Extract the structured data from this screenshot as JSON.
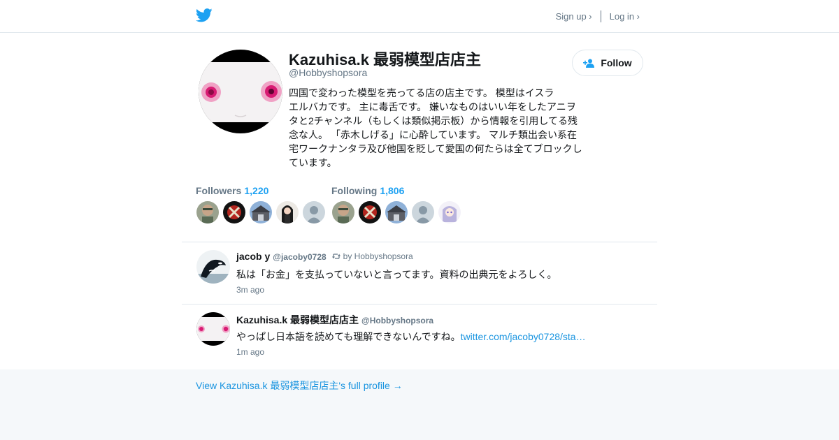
{
  "header": {
    "logo_icon": "twitter-bird-icon",
    "signup_label": "Sign up ›",
    "login_label": "Log in ›"
  },
  "profile": {
    "name": "Kazuhisa.k 最弱模型店店主",
    "handle": "@Hobbyshopsora",
    "bio_lines": [
      "四国で変わった模型を売ってる店の店主です。 模型はイスラ",
      "エルバカです。 主に毒舌です。 嫌いなものはいい年をしたアニヲ",
      "タと2チャンネル（もしくは類似掲示板）から情報を引用してる残",
      "念な人。 「赤木しげる」に心酔しています。 マルチ類出会い系在",
      "宅ワークナンタラ及び他国を貶して愛国の何たらは全てブロックし",
      "ています。"
    ],
    "follow_label": "Follow",
    "followers_label": "Followers",
    "followers_count": "1,220",
    "following_label": "Following",
    "following_count": "1,806"
  },
  "tweets": [
    {
      "name": "jacob y",
      "handle": "@jacoby0728",
      "retweet_text": "by Hobbyshopsora",
      "text": "私は「お金」を支払っていないと言ってます。資料の出典元をよろしく。",
      "link": "",
      "time": "3m ago"
    },
    {
      "name": "Kazuhisa.k 最弱模型店店主",
      "handle": "@Hobbyshopsora",
      "retweet_text": "",
      "text": "やっぱし日本語を読めても理解できないんですね。",
      "link": "twitter.com/jacoby0728/sta…",
      "time": "1m ago"
    }
  ],
  "footer": {
    "full_profile_link": "View Kazuhisa.k 最弱模型店店主's full profile →"
  },
  "colors": {
    "brand_blue": "#1da1f2",
    "link_blue": "#1b95e0",
    "muted_text": "#657786",
    "border": "#e1e8ed",
    "page_bg": "#f5f8fa"
  }
}
